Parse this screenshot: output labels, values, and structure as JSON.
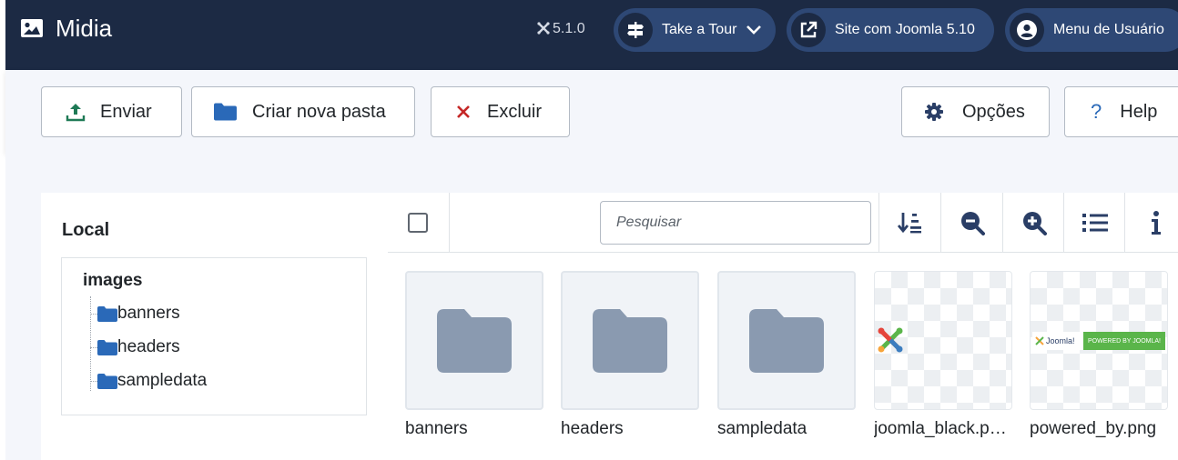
{
  "header": {
    "title": "Midia",
    "version": "5.1.0",
    "take_tour": "Take a Tour",
    "site_link": "Site com Joomla 5.10",
    "user_menu": "Menu de Usuário"
  },
  "toolbar": {
    "upload": "Enviar",
    "new_folder": "Criar nova pasta",
    "delete": "Excluir",
    "options": "Opções",
    "help": "Help"
  },
  "sidebar": {
    "heading": "Local",
    "root": "images",
    "folders": [
      "banners",
      "headers",
      "sampledata"
    ]
  },
  "browser": {
    "search_placeholder": "Pesquisar",
    "items": [
      {
        "name": "banners",
        "type": "folder"
      },
      {
        "name": "headers",
        "type": "folder"
      },
      {
        "name": "sampledata",
        "type": "folder"
      },
      {
        "name": "joomla_black.p…",
        "type": "image"
      },
      {
        "name": "powered_by.png",
        "type": "image"
      }
    ],
    "powered_by_logo_text": "Joomla!",
    "powered_by_banner_text": "POWERED BY JOOMLA!"
  },
  "colors": {
    "header_bg": "#1c2a44",
    "pill_bg": "#2e4875",
    "accent_blue": "#2a69b8",
    "folder_gray": "#8a9ab0",
    "delete_red": "#c52827",
    "joomla_green": "#5ab54a"
  }
}
